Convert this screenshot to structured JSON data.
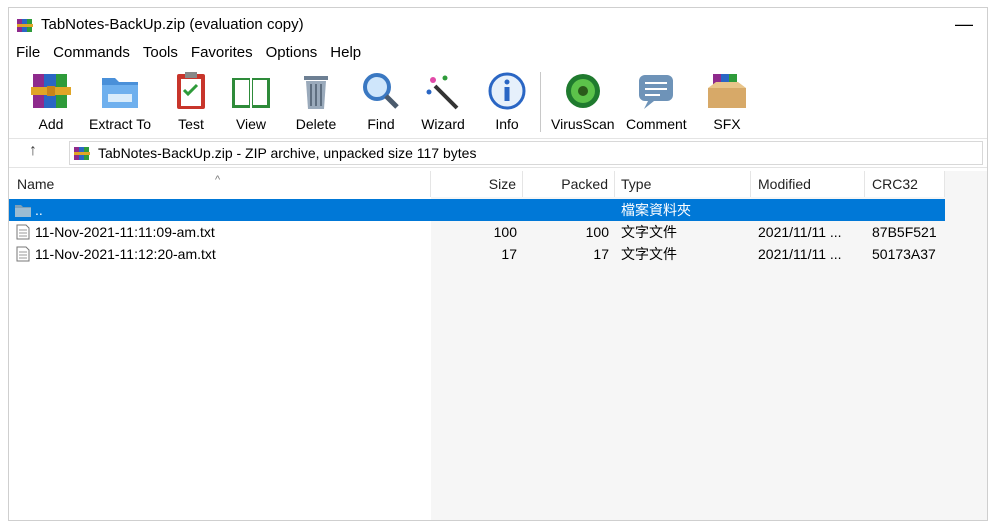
{
  "window": {
    "title": "TabNotes-BackUp.zip (evaluation copy)",
    "minimize": "—"
  },
  "menu": [
    "File",
    "Commands",
    "Tools",
    "Favorites",
    "Options",
    "Help"
  ],
  "toolbar": {
    "add": "Add",
    "extract": "Extract To",
    "test": "Test",
    "view": "View",
    "delete": "Delete",
    "find": "Find",
    "wizard": "Wizard",
    "info": "Info",
    "virusscan": "VirusScan",
    "comment": "Comment",
    "sfx": "SFX"
  },
  "pathbar": {
    "up": "↑",
    "text": "TabNotes-BackUp.zip - ZIP archive, unpacked size 117 bytes"
  },
  "columns": {
    "name": "Name",
    "size": "Size",
    "packed": "Packed",
    "type": "Type",
    "modified": "Modified",
    "crc": "CRC32"
  },
  "rows": [
    {
      "name": "..",
      "size": "",
      "packed": "",
      "type": "檔案資料夾",
      "modified": "",
      "crc": ""
    },
    {
      "name": "11-Nov-2021-11:11:09-am.txt",
      "size": "100",
      "packed": "100",
      "type": "文字文件",
      "modified": "2021/11/11 ...",
      "crc": "87B5F521"
    },
    {
      "name": "11-Nov-2021-11:12:20-am.txt",
      "size": "17",
      "packed": "17",
      "type": "文字文件",
      "modified": "2021/11/11 ...",
      "crc": "50173A37"
    }
  ],
  "colors": {
    "selection": "#0078d7",
    "folder": "#5b9bd5"
  }
}
